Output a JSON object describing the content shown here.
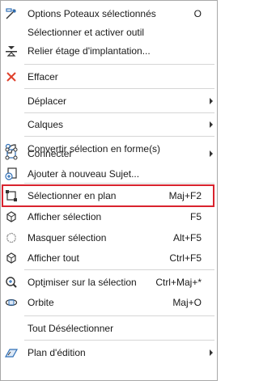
{
  "menu": {
    "items": [
      {
        "label": "Options Poteaux sélectionnés",
        "shortcut": "O",
        "icon": "column-options-icon"
      },
      {
        "label": "Sélectionner et activer outil",
        "shortcut": "",
        "icon": ""
      },
      {
        "label": "Relier étage d'implantation...",
        "shortcut": "",
        "icon": "link-story-icon"
      },
      {
        "label": "Effacer",
        "shortcut": "",
        "icon": "delete-x-icon"
      },
      {
        "label": "Déplacer",
        "shortcut": "",
        "icon": "",
        "submenu": true
      },
      {
        "label": "Calques",
        "shortcut": "",
        "icon": "",
        "submenu": true
      },
      {
        "label": "Convertir sélection en forme(s)",
        "shortcut": "",
        "icon": "convert-to-morph-icon"
      },
      {
        "label": "Connecter",
        "shortcut": "",
        "icon": "connect-icon",
        "submenu": true
      },
      {
        "label": "Ajouter à nouveau Sujet...",
        "shortcut": "",
        "icon": "add-to-issue-icon"
      },
      {
        "label": "Sélectionner en plan",
        "shortcut": "Maj+F2",
        "icon": "select-in-plan-icon"
      },
      {
        "label": "Afficher sélection",
        "shortcut": "F5",
        "icon": "show-selection-icon"
      },
      {
        "label": "Masquer sélection",
        "shortcut": "Alt+F5",
        "icon": "hide-selection-icon"
      },
      {
        "label": "Afficher tout",
        "shortcut": "Ctrl+F5",
        "icon": "show-all-icon"
      },
      {
        "label": "Optimiser sur la sélection",
        "shortcut": "Ctrl+Maj+*",
        "icon": "zoom-selection-icon"
      },
      {
        "label": "Orbite",
        "shortcut": "Maj+O",
        "icon": "orbit-icon"
      },
      {
        "label": "Tout Désélectionner",
        "shortcut": "",
        "icon": ""
      },
      {
        "label": "Plan d'édition",
        "shortcut": "",
        "icon": "editing-plane-icon",
        "submenu": true
      }
    ]
  },
  "colors": {
    "highlight_border": "#d9232e",
    "delete_icon": "#e0402b",
    "icon_blue": "#2f6fb6"
  }
}
